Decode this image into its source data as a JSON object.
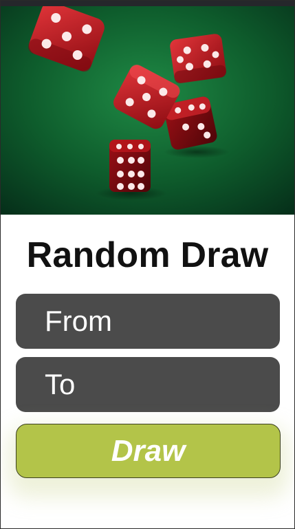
{
  "screen": {
    "title": "Random Draw"
  },
  "hero": {
    "image_subject": "red dice rolling on green felt",
    "icon": "dice-image"
  },
  "form": {
    "from_placeholder": "From",
    "to_placeholder": "To",
    "draw_label": "Draw"
  },
  "colors": {
    "status_bar": "#25272b",
    "felt_green": "#0e5c2c",
    "dice_red": "#c8191e",
    "field_background": "#4b4b4b",
    "field_text": "#ffffff",
    "draw_button": "#b3c449",
    "title_text": "#111111"
  }
}
